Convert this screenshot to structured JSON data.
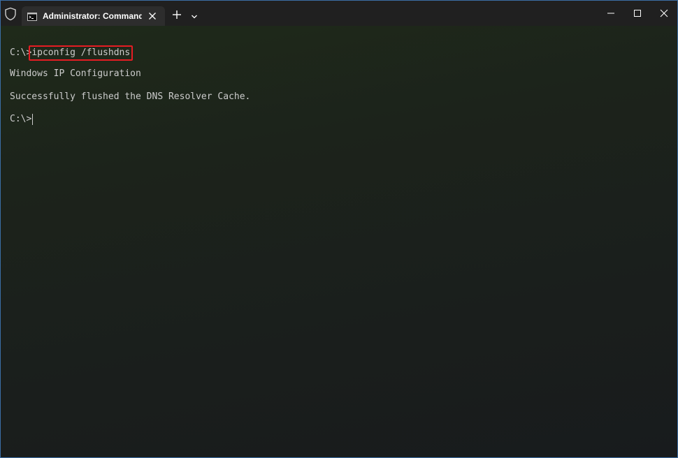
{
  "titlebar": {
    "tab_title": "Administrator: Command Prompt"
  },
  "icons": {
    "shield": "shield-icon",
    "tab": "command-prompt-icon",
    "tab_close": "close-icon",
    "new_tab": "plus-icon",
    "dropdown": "chevron-down-icon",
    "minimize": "minimize-icon",
    "maximize": "maximize-icon",
    "close": "close-icon"
  },
  "terminal": {
    "prompt": "C:\\>",
    "command": "ipconfig /flushdns",
    "output_line_1": "Windows IP Configuration",
    "output_line_2": "Successfully flushed the DNS Resolver Cache.",
    "current_prompt": "C:\\>"
  },
  "colors": {
    "highlight_border": "#e51c23",
    "text": "#cccccc",
    "titlebar": "#202020",
    "tab": "#2d2d2d"
  }
}
